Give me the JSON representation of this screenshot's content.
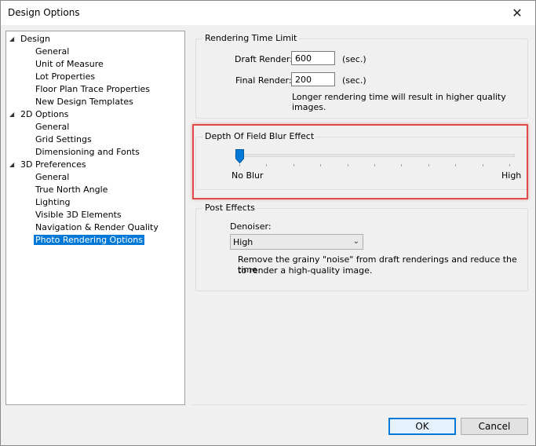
{
  "window": {
    "title": "Design Options",
    "close_glyph": "✕"
  },
  "tree": {
    "groups": [
      {
        "label": "Design",
        "children": [
          "General",
          "Unit of Measure",
          "Lot Properties",
          "Floor Plan Trace Properties",
          "New Design Templates"
        ]
      },
      {
        "label": "2D Options",
        "children": [
          "General",
          "Grid Settings",
          "Dimensioning and Fonts"
        ]
      },
      {
        "label": "3D Preferences",
        "children": [
          "General",
          "True North Angle",
          "Lighting",
          "Visible 3D Elements",
          "Navigation & Render Quality",
          "Photo Rendering Options"
        ]
      }
    ],
    "selected": "Photo Rendering Options",
    "expand_glyph": "◢"
  },
  "rendering_time": {
    "legend": "Rendering Time Limit",
    "draft_label": "Draft Render:",
    "draft_value": "600",
    "final_label": "Final Render:",
    "final_value": "200",
    "unit": "(sec.)",
    "note_line1": "Longer rendering time will result in higher quality",
    "note_line2": "images."
  },
  "dof": {
    "legend": "Depth Of Field Blur Effect",
    "min_label": "No Blur",
    "max_label": "High",
    "value_fraction": 0.0,
    "tick_count": 10
  },
  "post_effects": {
    "legend": "Post Effects",
    "denoiser_label": "Denoiser:",
    "denoiser_value": "High",
    "note_line1": "Remove the grainy \"noise\" from draft renderings and reduce the time",
    "note_line2": "to render a high-quality image."
  },
  "buttons": {
    "ok": "OK",
    "cancel": "Cancel"
  },
  "colors": {
    "accent": "#0078d7",
    "highlight_box": "#e04a4a"
  }
}
